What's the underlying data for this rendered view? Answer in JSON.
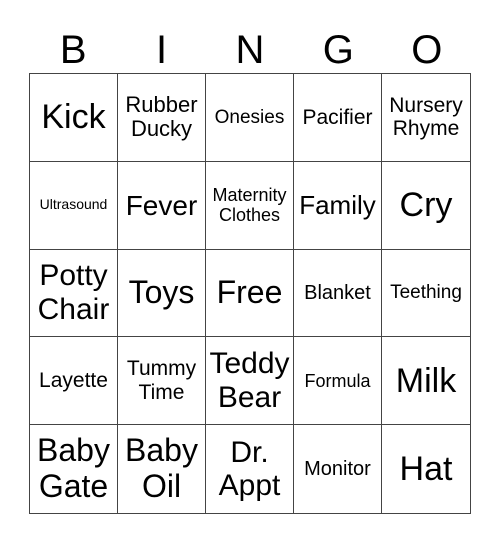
{
  "header": [
    "B",
    "I",
    "N",
    "G",
    "O"
  ],
  "cells": [
    "Kick",
    "Rubber Ducky",
    "Onesies",
    "Pacifier",
    "Nursery Rhyme",
    "Ultrasound",
    "Fever",
    "Maternity Clothes",
    "Family",
    "Cry",
    "Potty Chair",
    "Toys",
    "Free",
    "Blanket",
    "Teething",
    "Layette",
    "Tummy Time",
    "Teddy Bear",
    "Formula",
    "Milk",
    "Baby Gate",
    "Baby Oil",
    "Dr. Appt",
    "Monitor",
    "Hat"
  ]
}
